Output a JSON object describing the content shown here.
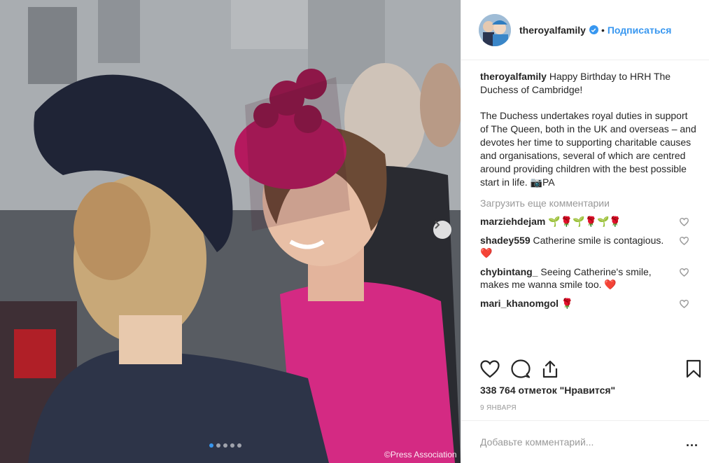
{
  "post": {
    "username": "theroyalfamily",
    "separator": "•",
    "follow_label": "Подписаться",
    "watermark": "©Press Association",
    "carousel": {
      "count": 5,
      "active": 0
    }
  },
  "caption": {
    "username": "theroyalfamily",
    "line1": "Happy Birthday to HRH The Duchess of Cambridge!",
    "line2": "The Duchess undertakes royal duties in support of The Queen, both in the UK and overseas – and devotes her time to supporting charitable causes and organisations, several of which are centred around providing children with the best possible start in life. 📷PA"
  },
  "load_more": "Загрузить еще комментарии",
  "comments": [
    {
      "user": "marziehdejam",
      "text": "🌱🌹🌱🌹🌱🌹"
    },
    {
      "user": "shadey559",
      "text": "Catherine smile is contagious. ❤️"
    },
    {
      "user": "chybintang_",
      "text": "Seeing Catherine's smile, makes me wanna smile too. ❤️"
    },
    {
      "user": "mari_khanomgol",
      "text": "🌹"
    }
  ],
  "likes": "338 764 отметок \"Нравится\"",
  "date": "9 ЯНВАРЯ",
  "comment_box": {
    "placeholder": "Добавьте комментарий...",
    "more": "..."
  },
  "colors": {
    "accent": "#3897f0",
    "text": "#262626",
    "muted": "#999999",
    "border": "#efefef"
  },
  "icons": {
    "like": "heart-icon",
    "comment": "comment-icon",
    "share": "share-icon",
    "save": "bookmark-icon",
    "next": "chevron-right-icon",
    "verified": "verified-badge-icon"
  }
}
